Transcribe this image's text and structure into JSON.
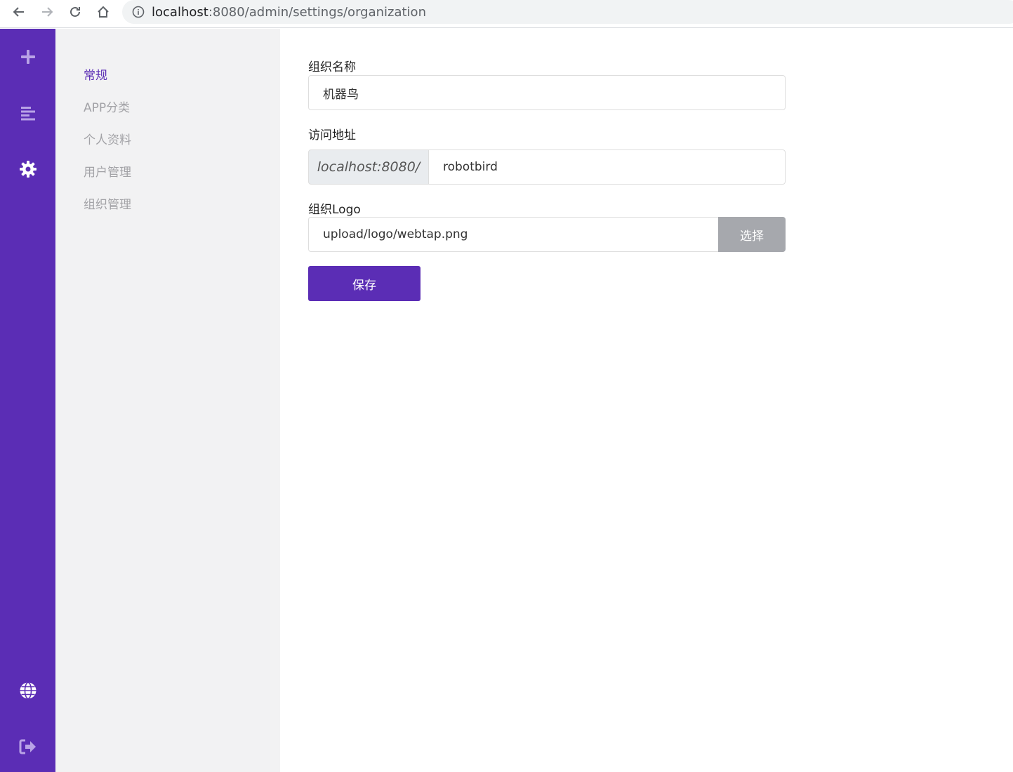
{
  "browser": {
    "url_host": "localhost",
    "url_rest": ":8080/admin/settings/organization"
  },
  "sidebar": {
    "icons": [
      "plus-icon",
      "menu-lines-icon",
      "gear-icon",
      "globe-icon",
      "sign-out-icon"
    ],
    "color": "#5b2db5"
  },
  "submenu": {
    "items": [
      {
        "label": "常规",
        "active": true
      },
      {
        "label": "APP分类",
        "active": false
      },
      {
        "label": "个人资料",
        "active": false
      },
      {
        "label": "用户管理",
        "active": false
      },
      {
        "label": "组织管理",
        "active": false
      }
    ]
  },
  "form": {
    "org_name_label": "组织名称",
    "org_name_value": "机器鸟",
    "access_label": "访问地址",
    "access_prefix": "localhost:8080/",
    "access_value": "robotbird",
    "logo_label": "组织Logo",
    "logo_value": "upload/logo/webtap.png",
    "choose_label": "选择",
    "save_label": "保存"
  },
  "colors": {
    "accent": "#5b2db5",
    "submenu_bg": "#f2f2f3",
    "choose_btn": "#a6a8ad"
  }
}
